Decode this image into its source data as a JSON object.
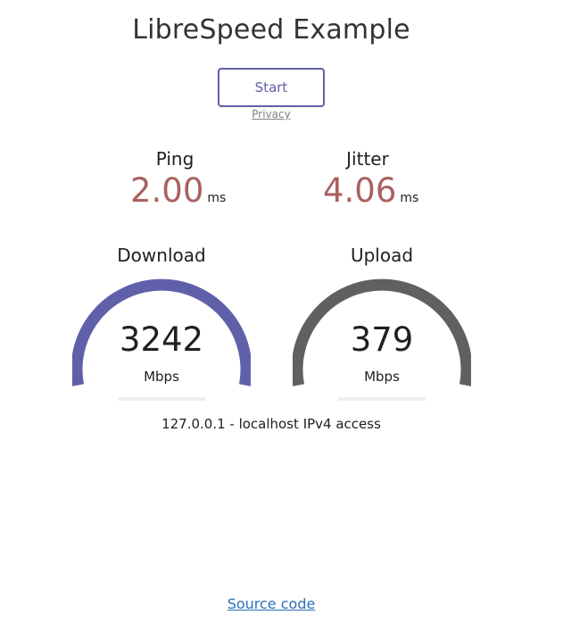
{
  "header": {
    "title": "LibreSpeed Example"
  },
  "controls": {
    "start_label": "Start",
    "privacy_label": "Privacy"
  },
  "ping": {
    "label": "Ping",
    "value": "2.00",
    "unit": "ms"
  },
  "jitter": {
    "label": "Jitter",
    "value": "4.06",
    "unit": "ms"
  },
  "download": {
    "label": "Download",
    "value": "3242",
    "unit": "Mbps",
    "progress": 0
  },
  "upload": {
    "label": "Upload",
    "value": "379",
    "unit": "Mbps",
    "progress": 0
  },
  "ip_info": "127.0.0.1 - localhost IPv4 access",
  "footer": {
    "source_label": "Source code"
  },
  "colors": {
    "download_gauge": "#6060aa",
    "upload_gauge": "#606060",
    "value_text": "#aa6060",
    "accent": "#6060aa",
    "link": "#2a70b8"
  }
}
